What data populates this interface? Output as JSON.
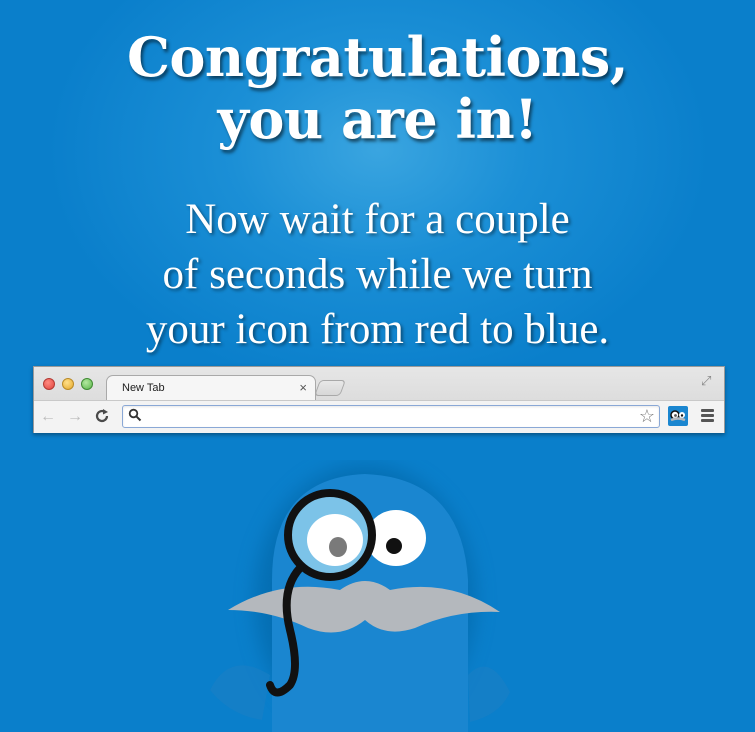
{
  "headline": {
    "line1": "Congratulations,",
    "line2": "you are in!"
  },
  "subtext": {
    "line1": "Now wait for a couple",
    "line2": "of seconds while we turn",
    "line3": "your icon from red to blue."
  },
  "browser": {
    "tab_label": "New Tab",
    "tab_close_glyph": "×",
    "fullscreen_glyph": "⤢",
    "back_glyph": "←",
    "forward_glyph": "→",
    "reload_glyph": "C",
    "search_glyph": "🔍",
    "star_glyph": "☆",
    "address_value": "",
    "icons": [
      "close-icon",
      "minimize-icon",
      "zoom-icon",
      "fullscreen-icon",
      "back-arrow-icon",
      "forward-arrow-icon",
      "reload-icon",
      "search-icon",
      "star-icon",
      "extension-icon",
      "menu-icon"
    ]
  },
  "colors": {
    "background": "#0a7fcb",
    "highlight": "#3aa5e0",
    "monster_body": "#1a86d0",
    "mustache": "#b4b8bd",
    "monocle": "#111111"
  }
}
